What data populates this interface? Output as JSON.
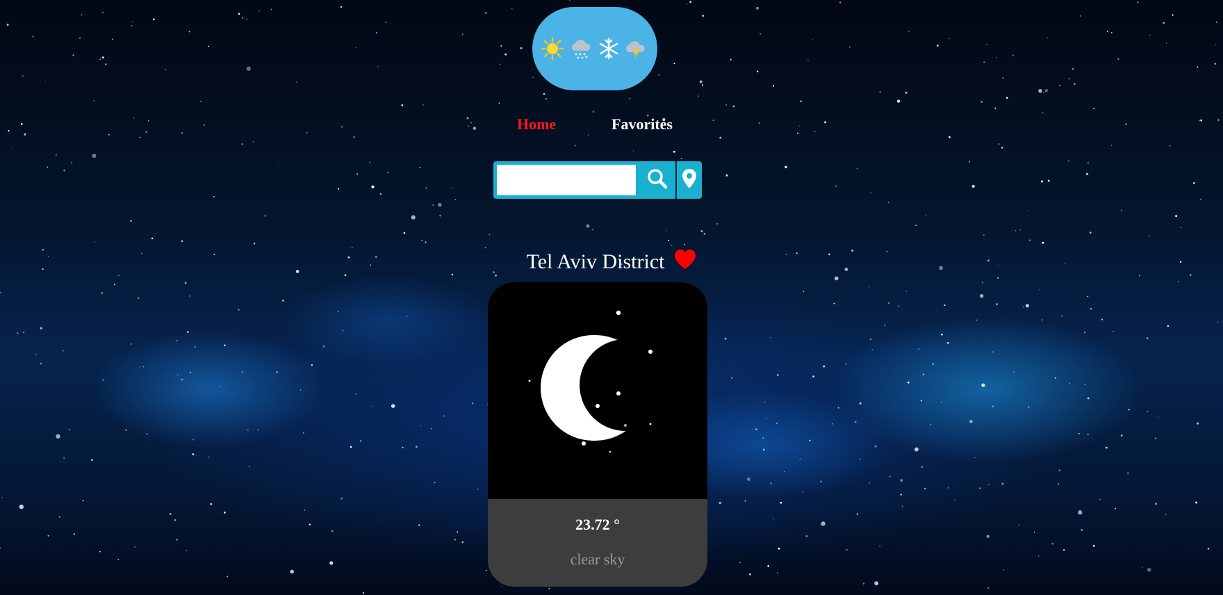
{
  "app": {
    "logo_icons": [
      "sun-icon",
      "snow-rain-cloud-icon",
      "snowflake-icon",
      "thunder-cloud-icon"
    ]
  },
  "nav": {
    "home_label": "Home",
    "favorites_label": "Favorites",
    "active": "Home"
  },
  "search": {
    "value": "",
    "placeholder": "",
    "search_icon": "search-icon",
    "location_icon": "location-pin-icon"
  },
  "weather": {
    "location": "Tel Aviv District",
    "favorite": true,
    "temperature": "23.72 °",
    "description": "clear sky",
    "condition_icon": "crescent-moon-icon"
  },
  "colors": {
    "accent_active": "#ff1a1a",
    "logo_pill": "#4bb3e6",
    "search_bar": "#1ab0cf",
    "heart": "#ff0000",
    "card_bottom": "#3d3d3d",
    "card_image": "#000000"
  }
}
